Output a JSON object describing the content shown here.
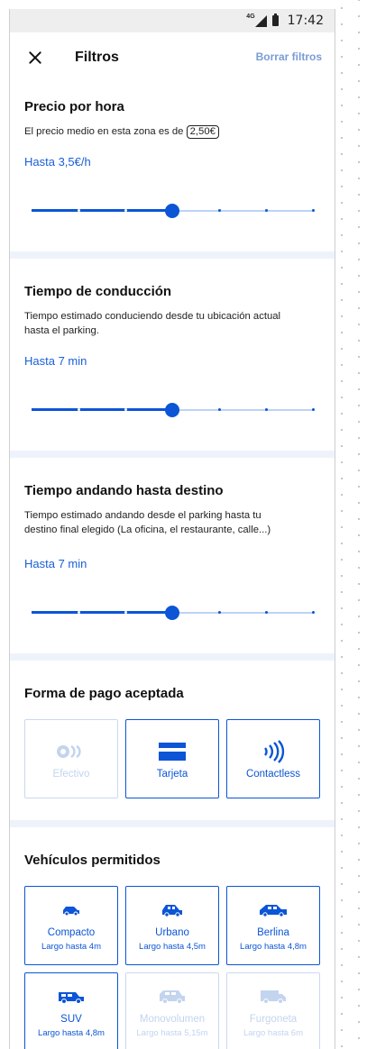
{
  "status": {
    "network": "4G",
    "time": "17:42"
  },
  "header": {
    "title": "Filtros",
    "clear_label": "Borrar filtros"
  },
  "price": {
    "title": "Precio por hora",
    "desc": "El precio medio en esta zona es de",
    "avg": "2,50€",
    "value_label": "Hasta 3,5€/h",
    "slider_fraction": 0.5
  },
  "driving": {
    "title": "Tiempo de conducción",
    "desc": "Tiempo estimado conduciendo desde tu ubicación actual hasta el parking.",
    "value_label": "Hasta 7 min",
    "slider_fraction": 0.5
  },
  "walking": {
    "title": "Tiempo andando hasta destino",
    "desc": "Tiempo estimado andando desde el parking hasta tu destino final elegido (La oficina, el restaurante, calle...)",
    "value_label": "Hasta 7 min",
    "slider_fraction": 0.5
  },
  "payment": {
    "title": "Forma de pago aceptada",
    "options": [
      {
        "label": "Efectivo",
        "icon": "coins-icon",
        "enabled": false
      },
      {
        "label": "Tarjeta",
        "icon": "credit-card-icon",
        "enabled": true
      },
      {
        "label": "Contactless",
        "icon": "contactless-icon",
        "enabled": true
      }
    ]
  },
  "vehicles": {
    "title": "Vehículos permitidos",
    "options": [
      {
        "label": "Compacto",
        "sub": "Largo hasta 4m",
        "icon": "compact-car-icon",
        "enabled": true
      },
      {
        "label": "Urbano",
        "sub": "Largo hasta 4,5m",
        "icon": "urban-car-icon",
        "enabled": true
      },
      {
        "label": "Berlina",
        "sub": "Largo hasta 4,8m",
        "icon": "sedan-car-icon",
        "enabled": true
      },
      {
        "label": "SUV",
        "sub": "Largo hasta 4,8m",
        "icon": "suv-icon",
        "enabled": true
      },
      {
        "label": "Monovolumen",
        "sub": "Largo hasta 5,15m",
        "icon": "minivan-icon",
        "enabled": false
      },
      {
        "label": "Furgoneta",
        "sub": "Largo hasta 6m",
        "icon": "van-icon",
        "enabled": false
      }
    ]
  },
  "colors": {
    "accent": "#0b55d6",
    "link": "#7b9bd6",
    "disabled": "#c3d4ef",
    "separator": "#eef3fb"
  }
}
